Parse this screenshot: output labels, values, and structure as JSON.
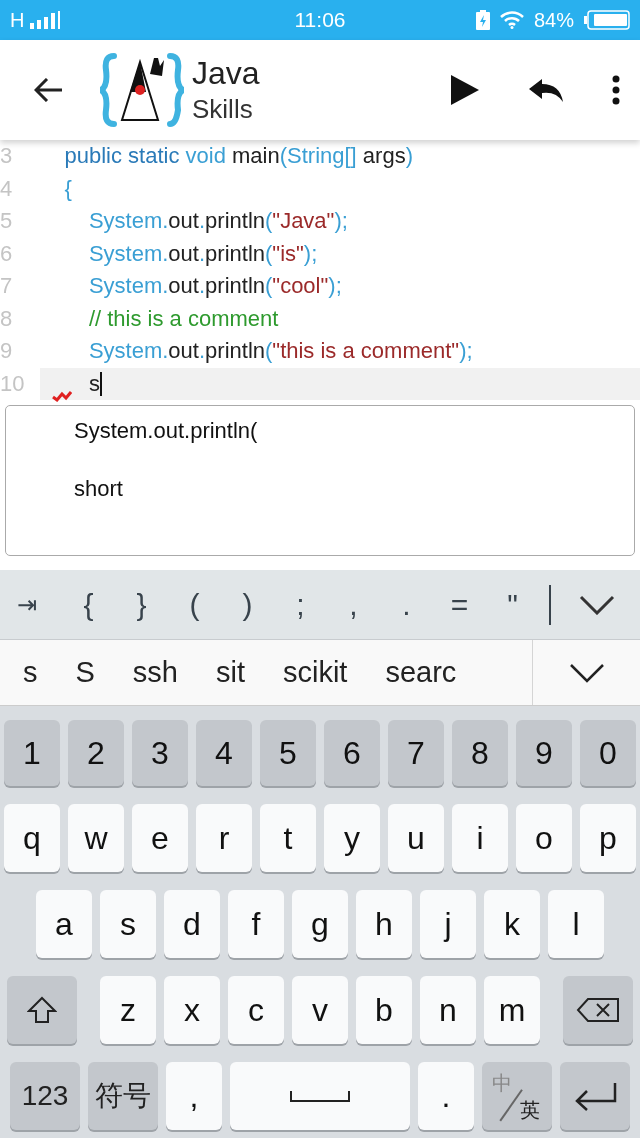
{
  "status_bar": {
    "network": "H",
    "time": "11:06",
    "battery": "84%"
  },
  "app_bar": {
    "title": "Java",
    "subtitle": "Skills"
  },
  "editor": {
    "lines": [
      {
        "number": "3",
        "current": false,
        "tokens": [
          {
            "t": "    public static ",
            "kind": "keyword"
          },
          {
            "t": "void ",
            "kind": "type"
          },
          {
            "t": "main",
            "kind": "plain"
          },
          {
            "t": "(String[] ",
            "kind": "type"
          },
          {
            "t": "args",
            "kind": "plain"
          },
          {
            "t": ")",
            "kind": "type"
          }
        ]
      },
      {
        "number": "4",
        "current": false,
        "tokens": [
          {
            "t": "    {",
            "kind": "type"
          }
        ]
      },
      {
        "number": "5",
        "current": false,
        "tokens": [
          {
            "t": "        System.",
            "kind": "type"
          },
          {
            "t": "out",
            "kind": "plain"
          },
          {
            "t": ".",
            "kind": "type"
          },
          {
            "t": "println",
            "kind": "plain"
          },
          {
            "t": "(",
            "kind": "type"
          },
          {
            "t": "\"Java\"",
            "kind": "string"
          },
          {
            "t": ");",
            "kind": "type"
          }
        ]
      },
      {
        "number": "6",
        "current": false,
        "tokens": [
          {
            "t": "        System.",
            "kind": "type"
          },
          {
            "t": "out",
            "kind": "plain"
          },
          {
            "t": ".",
            "kind": "type"
          },
          {
            "t": "println",
            "kind": "plain"
          },
          {
            "t": "(",
            "kind": "type"
          },
          {
            "t": "\"is\"",
            "kind": "string"
          },
          {
            "t": ");",
            "kind": "type"
          }
        ]
      },
      {
        "number": "7",
        "current": false,
        "tokens": [
          {
            "t": "        System.",
            "kind": "type"
          },
          {
            "t": "out",
            "kind": "plain"
          },
          {
            "t": ".",
            "kind": "type"
          },
          {
            "t": "println",
            "kind": "plain"
          },
          {
            "t": "(",
            "kind": "type"
          },
          {
            "t": "\"cool\"",
            "kind": "string"
          },
          {
            "t": ");",
            "kind": "type"
          }
        ]
      },
      {
        "number": "8",
        "current": false,
        "tokens": [
          {
            "t": "        // this is a comment",
            "kind": "comment"
          }
        ]
      },
      {
        "number": "9",
        "current": false,
        "tokens": [
          {
            "t": "        System.",
            "kind": "type"
          },
          {
            "t": "out",
            "kind": "plain"
          },
          {
            "t": ".",
            "kind": "type"
          },
          {
            "t": "println",
            "kind": "plain"
          },
          {
            "t": "(",
            "kind": "type"
          },
          {
            "t": "\"this is a comment\"",
            "kind": "string"
          },
          {
            "t": ");",
            "kind": "type"
          }
        ]
      },
      {
        "number": "10",
        "current": true,
        "tokens": [
          {
            "t": "        s",
            "kind": "plain"
          }
        ]
      }
    ]
  },
  "autocomplete": {
    "items": [
      "System.out.println(",
      "short"
    ]
  },
  "symbol_bar": {
    "keys": [
      "⇥",
      "{",
      "}",
      "(",
      ")",
      ";",
      ",",
      ".",
      "=",
      "\""
    ]
  },
  "suggestions": [
    "s",
    "S",
    "ssh",
    "sit",
    "scikit",
    "searc"
  ],
  "keyboard": {
    "rows": [
      {
        "keys": [
          {
            "kind": "number",
            "label": "1"
          },
          {
            "kind": "number",
            "label": "2"
          },
          {
            "kind": "number",
            "label": "3"
          },
          {
            "kind": "number",
            "label": "4"
          },
          {
            "kind": "number",
            "label": "5"
          },
          {
            "kind": "number",
            "label": "6"
          },
          {
            "kind": "number",
            "label": "7"
          },
          {
            "kind": "number",
            "label": "8"
          },
          {
            "kind": "number",
            "label": "9"
          },
          {
            "kind": "number",
            "label": "0"
          }
        ]
      },
      {
        "keys": [
          {
            "kind": "letter",
            "label": "q"
          },
          {
            "kind": "letter",
            "label": "w"
          },
          {
            "kind": "letter",
            "label": "e"
          },
          {
            "kind": "letter",
            "label": "r"
          },
          {
            "kind": "letter",
            "label": "t"
          },
          {
            "kind": "letter",
            "label": "y"
          },
          {
            "kind": "letter",
            "label": "u"
          },
          {
            "kind": "letter",
            "label": "i"
          },
          {
            "kind": "letter",
            "label": "o"
          },
          {
            "kind": "letter",
            "label": "p"
          }
        ]
      },
      {
        "keys": [
          {
            "kind": "letter",
            "label": "a"
          },
          {
            "kind": "letter",
            "label": "s"
          },
          {
            "kind": "letter",
            "label": "d"
          },
          {
            "kind": "letter",
            "label": "f"
          },
          {
            "kind": "letter",
            "label": "g"
          },
          {
            "kind": "letter",
            "label": "h"
          },
          {
            "kind": "letter",
            "label": "j"
          },
          {
            "kind": "letter",
            "label": "k"
          },
          {
            "kind": "letter",
            "label": "l"
          }
        ]
      },
      {
        "keys": [
          {
            "kind": "shift"
          },
          {
            "kind": "letter",
            "label": "z"
          },
          {
            "kind": "letter",
            "label": "x"
          },
          {
            "kind": "letter",
            "label": "c"
          },
          {
            "kind": "letter",
            "label": "v"
          },
          {
            "kind": "letter",
            "label": "b"
          },
          {
            "kind": "letter",
            "label": "n"
          },
          {
            "kind": "letter",
            "label": "m"
          },
          {
            "kind": "backspace"
          }
        ]
      },
      {
        "keys": [
          {
            "kind": "func",
            "label": "123"
          },
          {
            "kind": "func",
            "label": "符号"
          },
          {
            "kind": "letter",
            "label": ","
          },
          {
            "kind": "space"
          },
          {
            "kind": "letter",
            "label": "."
          },
          {
            "kind": "lang",
            "label": "中",
            "label2": "英"
          },
          {
            "kind": "enter"
          }
        ]
      }
    ]
  }
}
